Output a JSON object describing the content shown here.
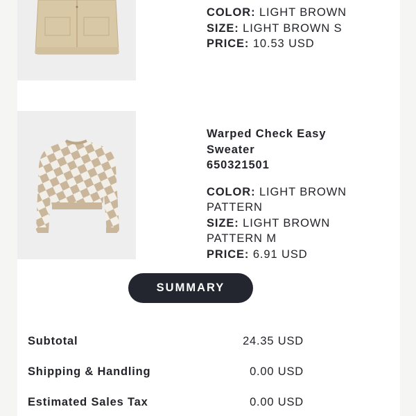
{
  "items": [
    {
      "color_label": "COLOR:",
      "color_value": "LIGHT BROWN",
      "size_label": "SIZE:",
      "size_value": "LIGHT BROWN S",
      "price_label": "PRICE:",
      "price_value": "10.53 USD",
      "image_icon": "jacket-image",
      "image_color": "#d9c8a6"
    },
    {
      "name_line1": "Warped Check Easy",
      "name_line2": "Sweater",
      "sku": "650321501",
      "color_label": "COLOR:",
      "color_value_line1": "LIGHT BROWN",
      "color_value_line2": "PATTERN",
      "size_label": "SIZE:",
      "size_value_line1": "LIGHT BROWN",
      "size_value_line2": "PATTERN M",
      "price_label": "PRICE:",
      "price_value": "6.91 USD",
      "image_icon": "checkered-sweater-image",
      "image_colors": [
        "#c9b69b",
        "#f2efe9"
      ]
    }
  ],
  "summary_button": {
    "label": "SUMMARY",
    "background": "#23262f"
  },
  "totals": [
    {
      "label": "Subtotal",
      "value": "24.35 USD"
    },
    {
      "label": "Shipping & Handling",
      "value": "0.00 USD"
    },
    {
      "label": "Estimated Sales Tax",
      "value": "0.00 USD"
    }
  ]
}
